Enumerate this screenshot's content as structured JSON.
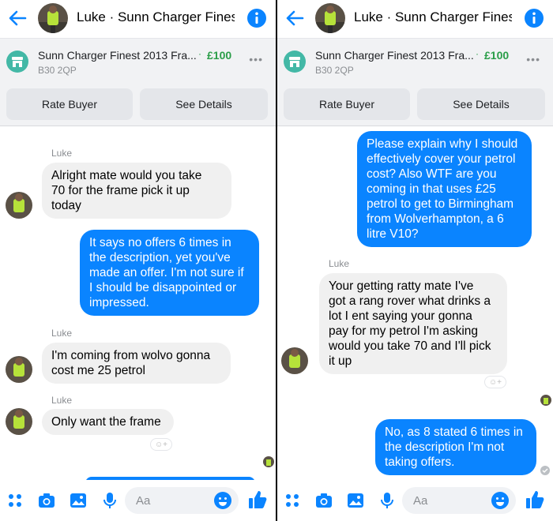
{
  "left": {
    "header": {
      "title": "Luke · Sunn Charger Fines..."
    },
    "listing": {
      "title": "Sunn Charger Finest 2013 Fra...",
      "dot": "·",
      "price": "£100",
      "location": "B30 2QP",
      "more": "•••"
    },
    "actions": {
      "rate": "Rate Buyer",
      "details": "See Details"
    },
    "messages": [
      {
        "sender": "Luke",
        "lines": [
          "Alright mate would you take",
          "70 for the frame pick it up",
          "today"
        ]
      },
      {
        "lines": [
          "It says no offers 6 times in",
          "the description, yet you've",
          "made an offer. I'm not sure if",
          "I should be disappointed or",
          "impressed."
        ]
      },
      {
        "sender": "Luke",
        "lines": [
          "I'm coming from wolvo gonna",
          "cost me 25 petrol"
        ]
      },
      {
        "sender": "Luke",
        "lines": [
          "Only want the frame"
        ]
      }
    ],
    "composer": {
      "placeholder": "Aa"
    }
  },
  "right": {
    "header": {
      "title": "Luke · Sunn Charger Fines..."
    },
    "listing": {
      "title": "Sunn Charger Finest 2013 Fra...",
      "dot": "·",
      "price": "£100",
      "location": "B30 2QP",
      "more": "•••"
    },
    "actions": {
      "rate": "Rate Buyer",
      "details": "See Details"
    },
    "messages": [
      {
        "lines": [
          "Please explain why I should",
          "effectively cover your petrol",
          "cost? Also WTF are you",
          "coming in that uses £25",
          "petrol to get to Birmingham",
          "from Wolverhampton, a 6",
          "litre V10?"
        ]
      },
      {
        "sender": "Luke",
        "lines": [
          "Your getting ratty mate I've",
          "got a rang rover what drinks a",
          "lot I ent saying your gonna",
          "pay for my petrol I'm asking",
          "would you take 70 and I'll pick",
          "it up"
        ]
      },
      {
        "lines": [
          "No, as 8 stated 6 times in",
          "the description I'm not",
          "taking offers."
        ]
      }
    ],
    "composer": {
      "placeholder": "Aa"
    }
  },
  "icons": {
    "back": "arrow-left-icon",
    "info": "info-icon",
    "marketplace": "shop-icon",
    "apps": "apps-grid-icon",
    "camera": "camera-icon",
    "gallery": "image-icon",
    "mic": "microphone-icon",
    "emoji": "emoji-icon",
    "like": "thumbs-up-icon"
  },
  "colors": {
    "accent": "#0a84ff",
    "price": "#2a9d48",
    "bubble_in": "#f0f0f0",
    "listing_bg": "#f1f2f4"
  }
}
